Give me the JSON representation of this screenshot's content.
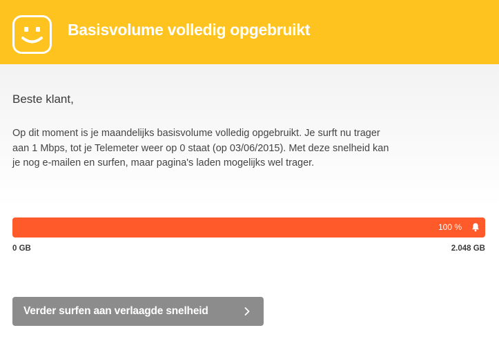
{
  "header": {
    "title": "Basisvolume volledig opgebruikt",
    "logo_icon": "smiley-logo-icon",
    "background": "#fec31f"
  },
  "content": {
    "greeting": "Beste klant,",
    "message": "Op dit moment is je maandelijks basisvolume volledig opgebruikt. Je surft nu trager aan 1 Mbps, tot je Telemeter weer op 0 staat (op 03/06/2015). Met deze snelheid kan je nog e-mailen en surfen, maar pagina's laden mogelijks wel trager."
  },
  "usage": {
    "percent_label": "100 %",
    "fill_fraction": 1.0,
    "fill_color": "#ff5a29",
    "alert_icon": "bell-icon",
    "min_label": "0 GB",
    "max_label": "2.048 GB"
  },
  "action": {
    "button_label": "Verder surfen aan verlaagde snelheid",
    "button_icon": "chevron-right-icon",
    "button_color": "#8c8c8c"
  }
}
